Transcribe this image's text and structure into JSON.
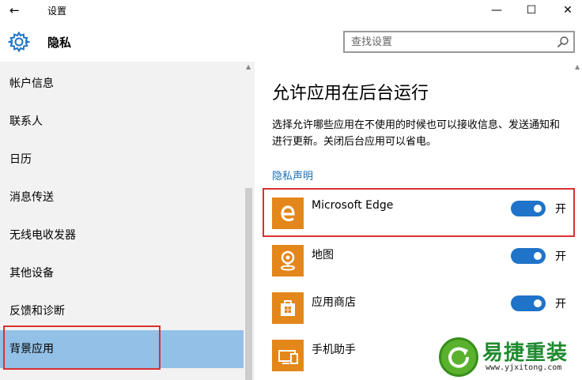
{
  "window": {
    "back_glyph": "←",
    "title": "设置",
    "minimize_glyph": "—",
    "maximize_glyph": "☐",
    "close_glyph": "✕"
  },
  "header": {
    "title": "隐私",
    "icon": "gear-icon",
    "search_placeholder": "查找设置"
  },
  "sidebar": {
    "items": [
      {
        "label": "帐户信息",
        "selected": false
      },
      {
        "label": "联系人",
        "selected": false
      },
      {
        "label": "日历",
        "selected": false
      },
      {
        "label": "消息传送",
        "selected": false
      },
      {
        "label": "无线电收发器",
        "selected": false
      },
      {
        "label": "其他设备",
        "selected": false
      },
      {
        "label": "反馈和诊断",
        "selected": false
      },
      {
        "label": "背景应用",
        "selected": true
      }
    ]
  },
  "main": {
    "heading": "允许应用在后台运行",
    "description": "选择允许哪些应用在不使用的时候也可以接收信息、发送通知和进行更新。关闭后台应用可以省电。",
    "privacy_link": "隐私声明",
    "apps": [
      {
        "name": "Microsoft Edge",
        "icon": "edge-icon",
        "toggle_on": true,
        "state": "开"
      },
      {
        "name": "地图",
        "icon": "maps-icon",
        "toggle_on": true,
        "state": "开"
      },
      {
        "name": "应用商店",
        "icon": "store-icon",
        "toggle_on": true,
        "state": "开"
      },
      {
        "name": "手机助手",
        "icon": "phone-companion-icon",
        "toggle_on": null,
        "state": ""
      }
    ]
  },
  "colors": {
    "accent": "#1f73c8",
    "selected_bg": "#93c0e7",
    "app_tile": "#e3871b",
    "highlight": "#d9312f",
    "link": "#1a6fb6"
  },
  "watermark": {
    "name": "易捷重装",
    "url": "www.yjxitong.com"
  }
}
